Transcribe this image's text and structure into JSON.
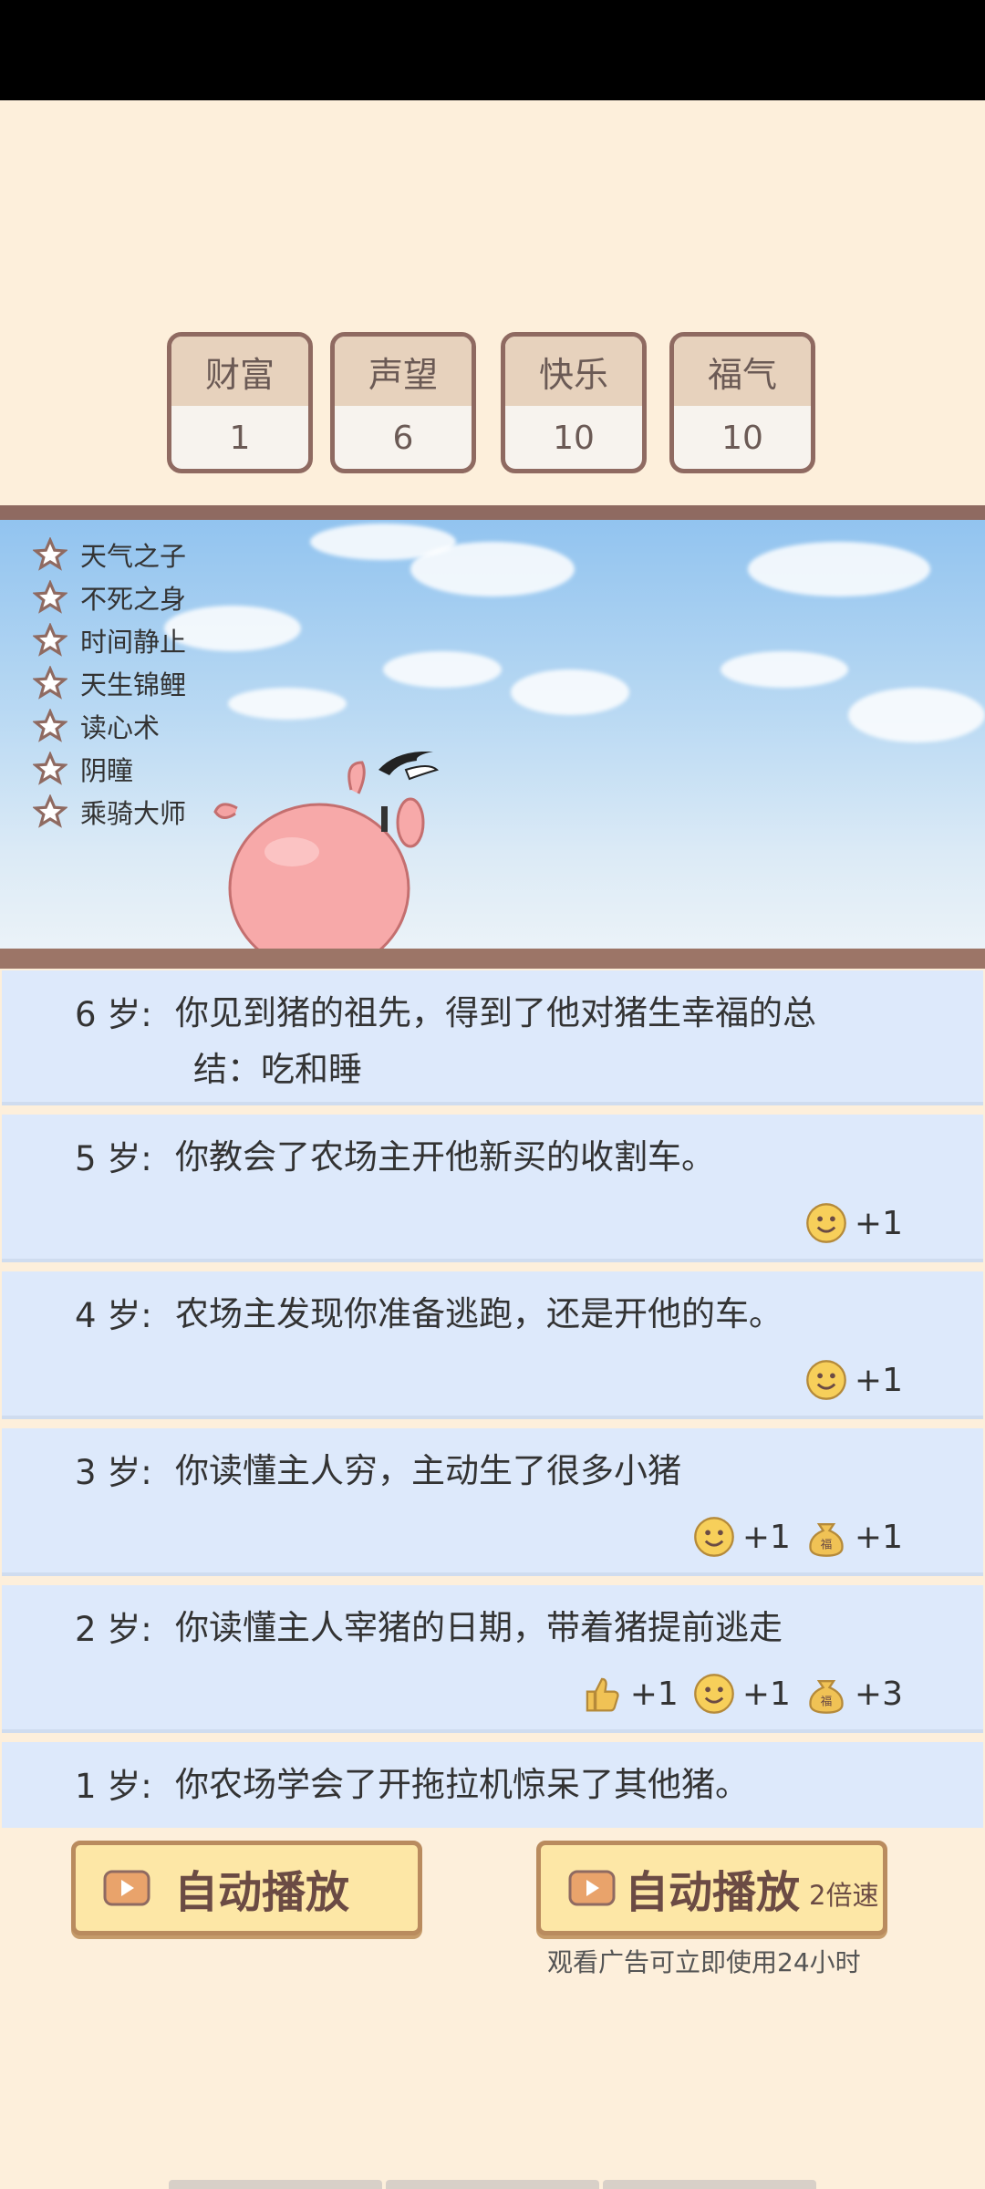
{
  "stats": [
    {
      "label": "财富",
      "value": "1"
    },
    {
      "label": "声望",
      "value": "6"
    },
    {
      "label": "快乐",
      "value": "10"
    },
    {
      "label": "福气",
      "value": "10"
    }
  ],
  "talents": [
    "天气之子",
    "不死之身",
    "时间静止",
    "天生锦鲤",
    "读心术",
    "阴瞳",
    "乘骑大师"
  ],
  "events": [
    {
      "age": "6 岁:",
      "text": "你见到猪的祖先，得到了他对猪生幸福的总",
      "text2": "结：吃和睡",
      "rewards": []
    },
    {
      "age": "5 岁:",
      "text": "你教会了农场主开他新买的收割车。",
      "rewards": [
        {
          "icon": "smile-icon",
          "value": "+1"
        }
      ]
    },
    {
      "age": "4 岁:",
      "text": "农场主发现你准备逃跑，还是开他的车。",
      "rewards": [
        {
          "icon": "smile-icon",
          "value": "+1"
        }
      ]
    },
    {
      "age": "3 岁:",
      "text": "你读懂主人穷，主动生了很多小猪",
      "rewards": [
        {
          "icon": "smile-icon",
          "value": "+1"
        },
        {
          "icon": "money-bag-icon",
          "value": "+1"
        }
      ]
    },
    {
      "age": "2 岁:",
      "text": "你读懂主人宰猪的日期，带着猪提前逃走",
      "rewards": [
        {
          "icon": "thumbs-up-icon",
          "value": "+1"
        },
        {
          "icon": "smile-icon",
          "value": "+1"
        },
        {
          "icon": "money-bag-icon",
          "value": "+3"
        }
      ]
    },
    {
      "age": "1 岁:",
      "text": "你农场学会了开拖拉机惊呆了其他猪。",
      "rewards": []
    }
  ],
  "buttons": {
    "auto_play": "自动播放",
    "auto_play_fast": "自动播放",
    "speed_label": "2倍速",
    "ad_note": "观看广告可立即使用24小时"
  },
  "money_bag_char": "福"
}
